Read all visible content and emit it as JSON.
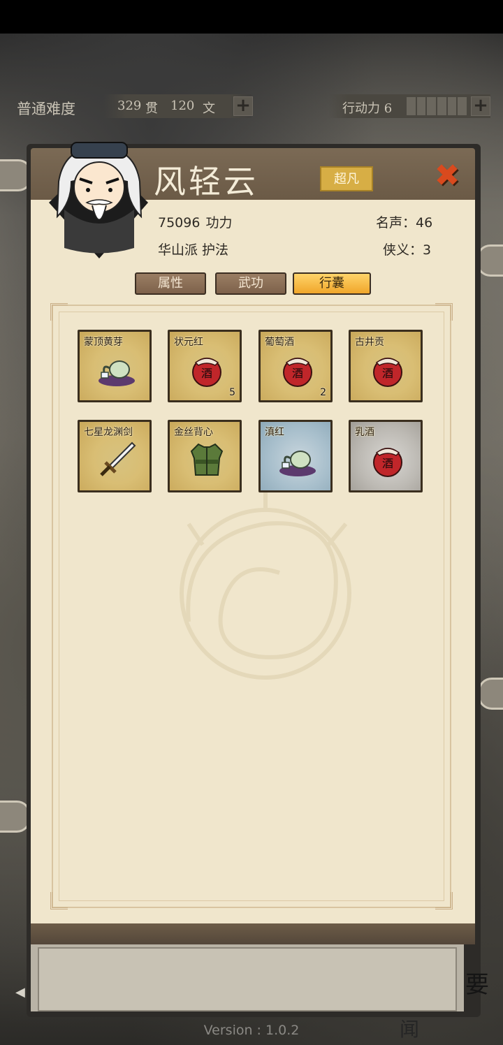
{
  "status": {
    "difficulty": "普通难度",
    "money_guan_value": "329",
    "money_guan_unit": "贯",
    "money_wen_value": "120",
    "money_wen_unit": "文",
    "action_points_label": "行动力 6",
    "plus": "+"
  },
  "character": {
    "name": "风轻云",
    "rank": "超凡",
    "close": "✖",
    "power_value": "75096",
    "power_label": "功力",
    "faction": "华山派 护法",
    "fame_label": "名声：",
    "fame_value": "46",
    "chivalry_label": "侠义：",
    "chivalry_value": "3"
  },
  "tabs": [
    {
      "label": "属性",
      "active": false
    },
    {
      "label": "武功",
      "active": false
    },
    {
      "label": "行囊",
      "active": true
    }
  ],
  "items": [
    {
      "name": "蒙顶黄芽",
      "icon": "teapot-icon",
      "quality": "gold",
      "qty": ""
    },
    {
      "name": "状元红",
      "icon": "wine-jar-icon",
      "quality": "gold",
      "qty": "5"
    },
    {
      "name": "葡萄酒",
      "icon": "wine-jar-icon",
      "quality": "gold",
      "qty": "2"
    },
    {
      "name": "古井贡",
      "icon": "wine-jar-icon",
      "quality": "gold",
      "qty": ""
    },
    {
      "name": "七星龙渊剑",
      "icon": "sword-icon",
      "quality": "gold",
      "qty": ""
    },
    {
      "name": "金丝背心",
      "icon": "vest-armor-icon",
      "quality": "gold",
      "qty": ""
    },
    {
      "name": "滇红",
      "icon": "teapot-icon",
      "quality": "blue",
      "qty": ""
    },
    {
      "name": "乳酒",
      "icon": "wine-jar-icon",
      "quality": "gray",
      "qty": ""
    }
  ],
  "jar_label": "酒",
  "footer": {
    "version": "Version : 1.0.2",
    "side_char_1": "要",
    "side_char_2": "闻"
  },
  "colors": {
    "gold_slot": "#d9be74",
    "blue_slot": "#a8bfcc",
    "gray_slot": "#bdbab4",
    "active_tab": "#f0a62a",
    "close_button": "#d94a1e"
  }
}
